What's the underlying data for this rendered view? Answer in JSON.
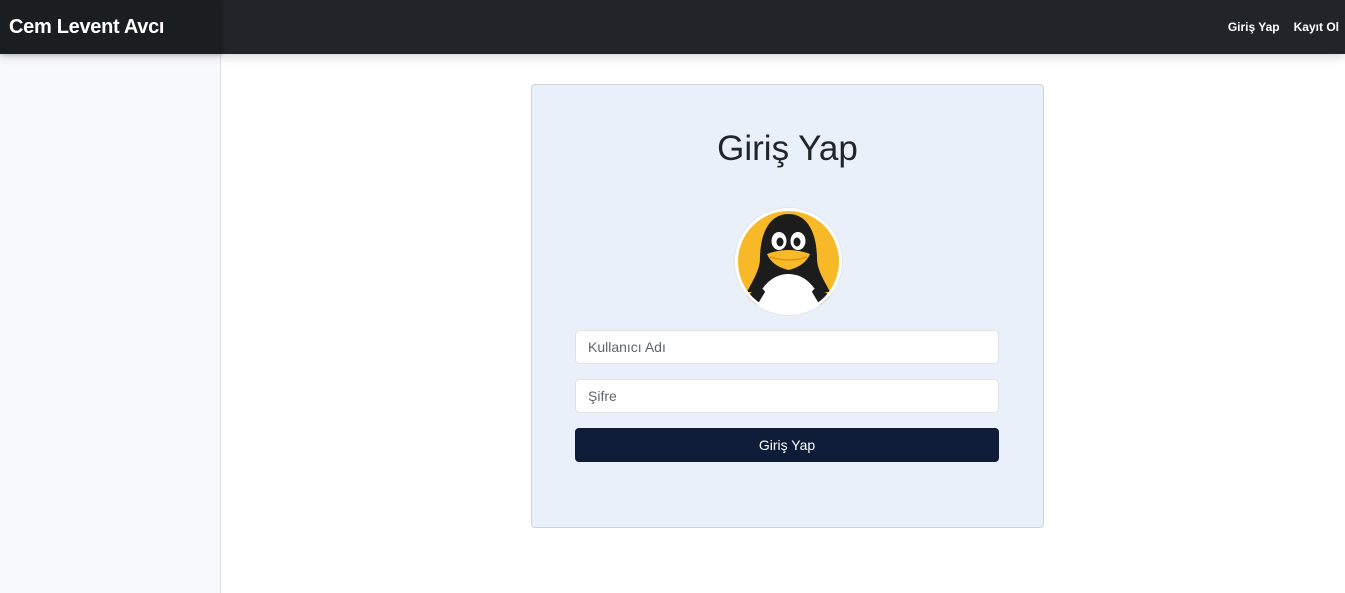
{
  "navbar": {
    "brand": "Cem Levent Avcı",
    "links": [
      {
        "label": "Giriş Yap"
      },
      {
        "label": "Kayıt Ol"
      }
    ]
  },
  "login_card": {
    "title": "Giriş Yap",
    "avatar_icon": "tux-penguin-icon",
    "username": {
      "placeholder": "Kullanıcı Adı",
      "value": ""
    },
    "password": {
      "placeholder": "Şifre",
      "value": ""
    },
    "submit_label": "Giriş Yap"
  },
  "colors": {
    "navbar_bg": "#212529",
    "card_bg": "#eaf0f9",
    "button_bg": "#0f1c38",
    "penguin_yellow": "#f7b928"
  }
}
